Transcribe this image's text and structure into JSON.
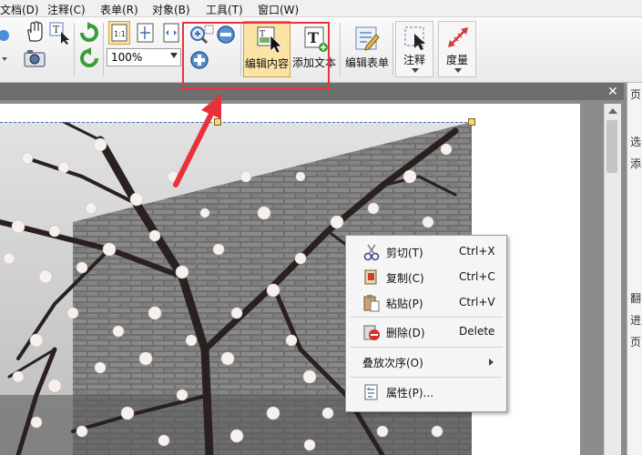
{
  "menubar": {
    "items": [
      "文档(D)",
      "注释(C)",
      "表单(R)",
      "对象(B)",
      "工具(T)",
      "窗口(W)"
    ]
  },
  "toolbar": {
    "zoom_value": "100%",
    "edit_content_label": "编辑内容",
    "add_text_label": "添加文本",
    "edit_form_label": "编辑表单",
    "annotate_label": "注释",
    "measure_label": "度量"
  },
  "right_panel": {
    "chars": [
      "页",
      "选",
      "添",
      "翻",
      "进",
      "页"
    ]
  },
  "context_menu": {
    "items": [
      {
        "label": "剪切(T)",
        "shortcut": "Ctrl+X"
      },
      {
        "label": "复制(C)",
        "shortcut": "Ctrl+C"
      },
      {
        "label": "粘贴(P)",
        "shortcut": "Ctrl+V"
      },
      {
        "label": "删除(D)",
        "shortcut": "Delete"
      },
      {
        "label": "叠放次序(O)",
        "shortcut": ""
      },
      {
        "label": "属性(P)...",
        "shortcut": ""
      }
    ]
  },
  "colors": {
    "highlight": "#e8323a",
    "active_button": "#fbe3a3"
  }
}
